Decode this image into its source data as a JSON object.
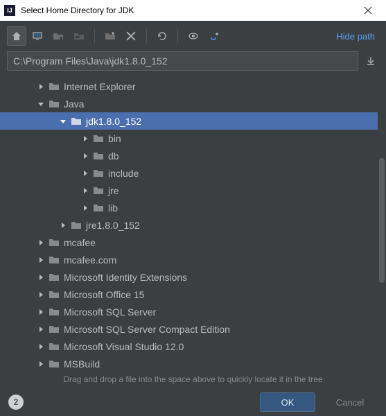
{
  "window": {
    "title": "Select Home Directory for JDK",
    "icon_text": "IJ"
  },
  "toolbar": {
    "hide_path": "Hide path"
  },
  "path": {
    "value": "C:\\Program Files\\Java\\jdk1.8.0_152"
  },
  "tree": {
    "nodes": [
      {
        "indent": 2,
        "expanded": false,
        "label": "Internet Explorer",
        "selected": false
      },
      {
        "indent": 2,
        "expanded": true,
        "label": "Java",
        "selected": false
      },
      {
        "indent": 4,
        "expanded": true,
        "label": "jdk1.8.0_152",
        "selected": true
      },
      {
        "indent": 6,
        "expanded": false,
        "label": "bin",
        "selected": false
      },
      {
        "indent": 6,
        "expanded": false,
        "label": "db",
        "selected": false
      },
      {
        "indent": 6,
        "expanded": false,
        "label": "include",
        "selected": false
      },
      {
        "indent": 6,
        "expanded": false,
        "label": "jre",
        "selected": false
      },
      {
        "indent": 6,
        "expanded": false,
        "label": "lib",
        "selected": false
      },
      {
        "indent": 4,
        "expanded": false,
        "label": "jre1.8.0_152",
        "selected": false
      },
      {
        "indent": 2,
        "expanded": false,
        "label": "mcafee",
        "selected": false
      },
      {
        "indent": 2,
        "expanded": false,
        "label": "mcafee.com",
        "selected": false
      },
      {
        "indent": 2,
        "expanded": false,
        "label": "Microsoft Identity Extensions",
        "selected": false
      },
      {
        "indent": 2,
        "expanded": false,
        "label": "Microsoft Office 15",
        "selected": false
      },
      {
        "indent": 2,
        "expanded": false,
        "label": "Microsoft SQL Server",
        "selected": false
      },
      {
        "indent": 2,
        "expanded": false,
        "label": "Microsoft SQL Server Compact Edition",
        "selected": false
      },
      {
        "indent": 2,
        "expanded": false,
        "label": "Microsoft Visual Studio 12.0",
        "selected": false
      },
      {
        "indent": 2,
        "expanded": false,
        "label": "MSBuild",
        "selected": false
      }
    ]
  },
  "hint": "Drag and drop a file into the space above to quickly locate it in the tree",
  "footer": {
    "step": "2",
    "ok": "OK",
    "cancel": "Cancel"
  }
}
